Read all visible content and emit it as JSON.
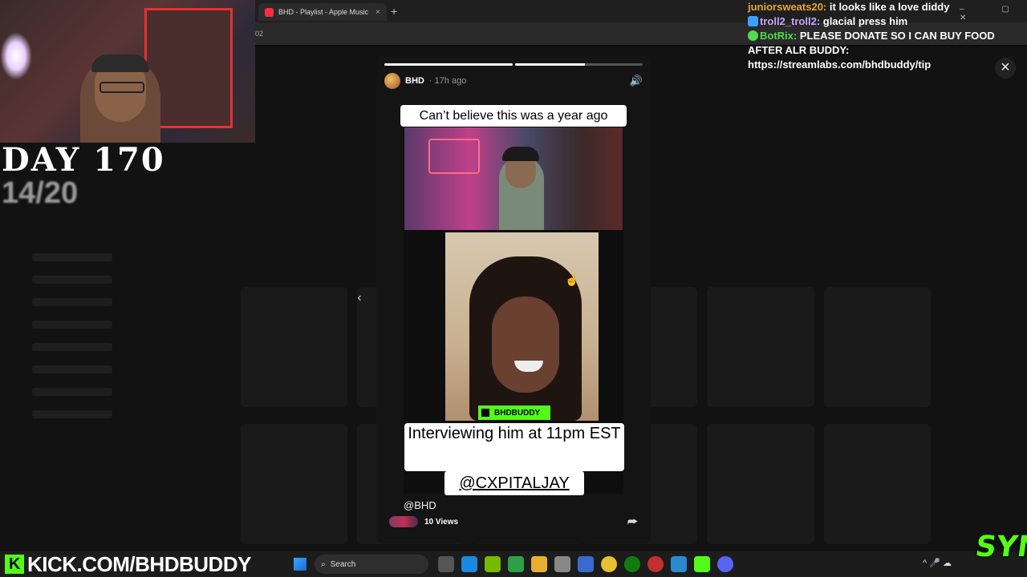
{
  "browser": {
    "tab_title": "BHD - Playlist - Apple Music",
    "tab_close": "×",
    "new_tab": "+",
    "address_fragment": "02",
    "window_controls": "– ▢ ✕"
  },
  "overlay": {
    "day_label": "DAY 170",
    "day_progress": "14/20",
    "kick_url": "KICK.COM/BHDBUDDY",
    "kick_logo": "K",
    "syn_logo": "SYN"
  },
  "chat": {
    "messages": [
      {
        "user": "juniorsweats20:",
        "text": "it looks like a love diddy"
      },
      {
        "user": "troll2_troll2:",
        "text": "glacial press him"
      },
      {
        "user": "BotRix:",
        "text": "PLEASE DONATE SO I CAN BUY FOOD AFTER ALR BUDDY: https://streamlabs.com/bhdbuddy/tip"
      }
    ]
  },
  "story": {
    "username": "BHD",
    "time_ago": "· 17h ago",
    "volume_icon": "🔊",
    "progress": [
      1.0,
      0.55
    ],
    "caption_top": "Can’t believe this was a year ago",
    "kick_badge": "BHDBUDDY",
    "caption_mid": "Interviewing him at 11pm EST",
    "caption_tag": "@CXPITALJAY",
    "handle": "@BHD",
    "views": "10 Views",
    "share_icon": "⮫",
    "prev_icon": "‹",
    "close_icon": "×"
  },
  "taskbar": {
    "search_placeholder": "Search",
    "tray": "^ 🎤 ☁"
  },
  "colors": {
    "kick_green": "#53fc18",
    "apple_music_red": "#fa2d48"
  }
}
